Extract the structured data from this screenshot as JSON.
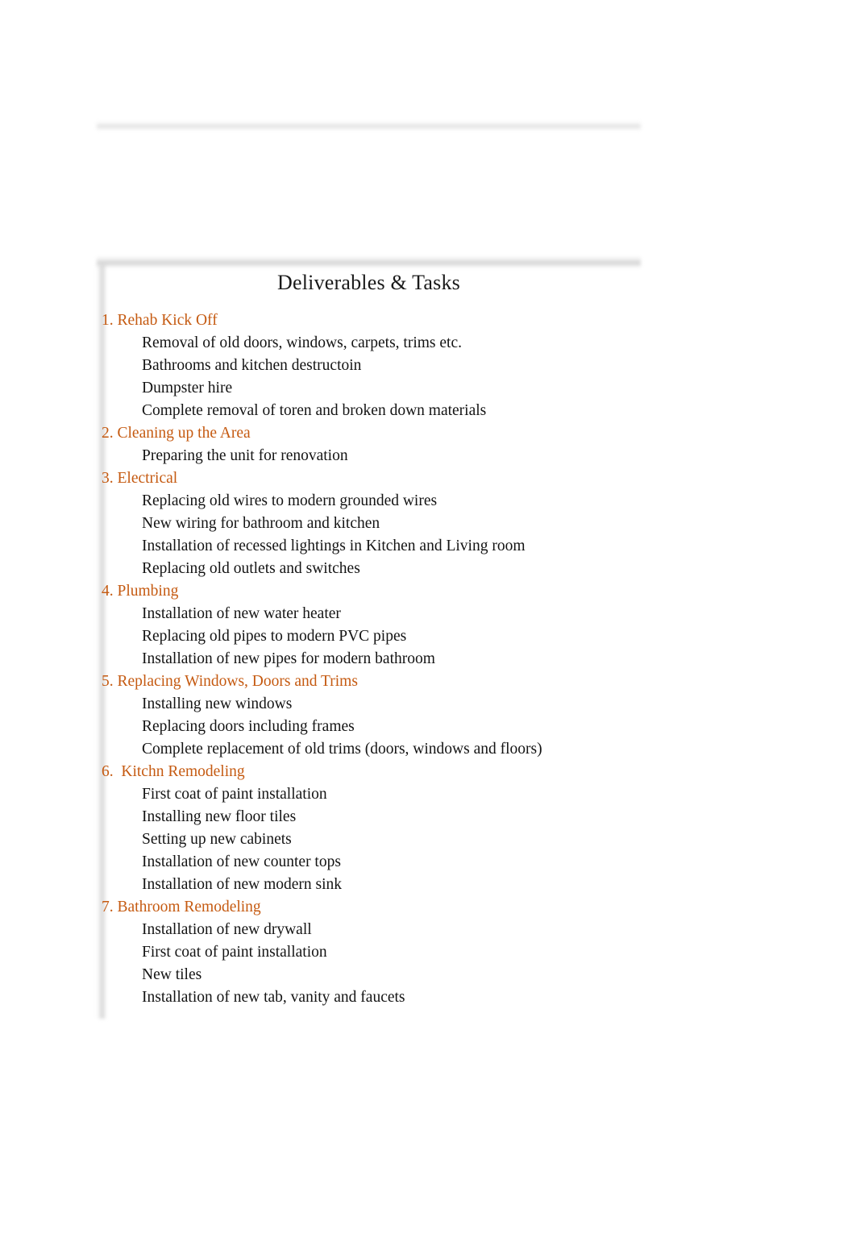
{
  "document": {
    "title": "Deliverables & Tasks",
    "accent_color": "#c55a11",
    "text_color": "#141414",
    "sections": [
      {
        "header": "1. Rehab Kick Off",
        "tasks": [
          "Removal of old doors, windows, carpets, trims etc.",
          "Bathrooms and kitchen destructoin",
          "Dumpster hire",
          "Complete removal of toren and broken down materials"
        ]
      },
      {
        "header": "2. Cleaning up the Area",
        "tasks": [
          "Preparing the unit for renovation"
        ]
      },
      {
        "header": "3. Electrical",
        "tasks": [
          "Replacing old wires to modern grounded wires",
          "New wiring for bathroom and kitchen",
          "Installation of recessed lightings in Kitchen and Living room",
          "Replacing old outlets and switches"
        ]
      },
      {
        "header": "4. Plumbing",
        "tasks": [
          "Installation of new water heater",
          "Replacing old pipes to modern PVC pipes",
          "Installation of new pipes for modern bathroom"
        ]
      },
      {
        "header": "5. Replacing Windows, Doors and Trims",
        "tasks": [
          "Installing new windows",
          "Replacing doors including frames",
          "Complete replacement of old trims (doors, windows and floors)"
        ]
      },
      {
        "header": "6.  Kitchn Remodeling",
        "tasks": [
          "First coat of paint installation",
          "Installing new floor tiles",
          "Setting up new cabinets",
          "Installation of new counter tops",
          "Installation of new modern sink"
        ]
      },
      {
        "header": "7. Bathroom Remodeling",
        "tasks": [
          "Installation of new drywall",
          "First coat of paint installation",
          "New tiles",
          "Installation of new tab, vanity and faucets"
        ]
      }
    ]
  }
}
